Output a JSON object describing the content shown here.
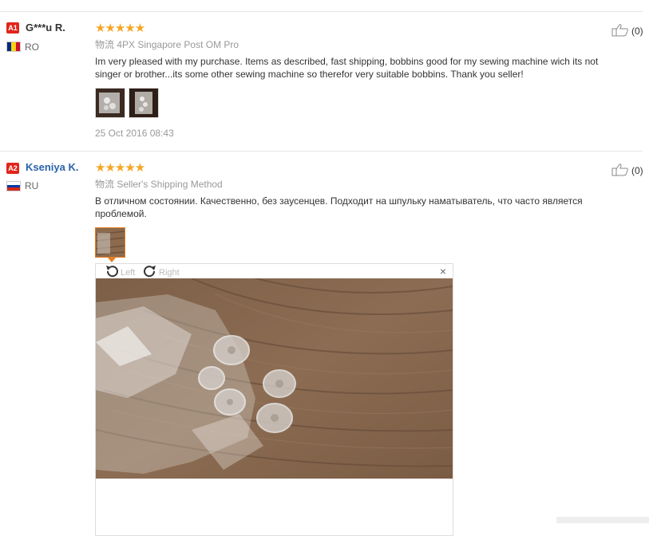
{
  "reviews": [
    {
      "badge": "A1",
      "name": "G***u R.",
      "country": "RO",
      "stars": "★★★★★",
      "logistics_label": "物流",
      "logistics": "4PX Singapore Post OM Pro",
      "text": "Im very pleased with my purchase. Items as described, fast shipping, bobbins good for my sewing machine wich its not singer or brother...its some other sewing machine so therefor very suitable bobbins. Thank you seller!",
      "date": "25 Oct 2016 08:43",
      "helpful": "(0)"
    },
    {
      "badge": "A2",
      "name": "Kseniya K.",
      "country": "RU",
      "stars": "★★★★★",
      "logistics_label": "物流",
      "logistics": "Seller's Shipping Method",
      "text": "В отличном состоянии. Качественно, без заусенцев. Подходит на шпульку наматыватель, что часто является проблемой.",
      "helpful": "(0)"
    }
  ],
  "viewer": {
    "left_label": "Left",
    "right_label": "Right",
    "close": "×"
  },
  "icons": {
    "thumbs_up": "thumbs-up-icon",
    "rotate_left": "rotate-left-icon",
    "rotate_right": "rotate-right-icon",
    "close": "close-icon"
  },
  "colors": {
    "badge": "#e1251b",
    "stars": "#f5a623",
    "link_name": "#2962a8"
  }
}
